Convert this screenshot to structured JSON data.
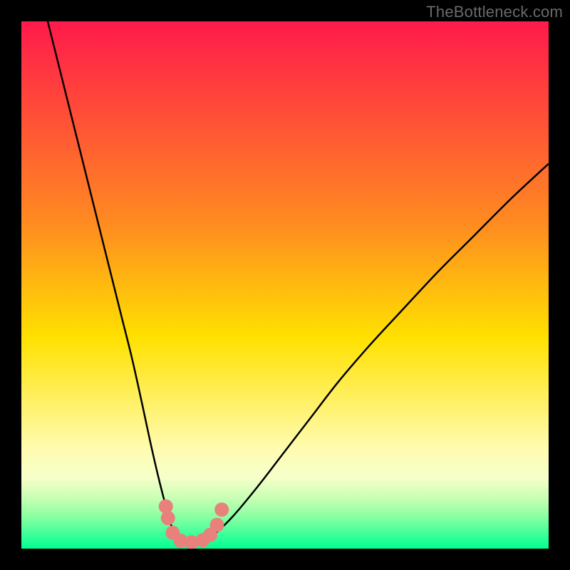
{
  "watermark": "TheBottleneck.com",
  "chart_data": {
    "type": "line",
    "title": "",
    "xlabel": "",
    "ylabel": "",
    "xlim": [
      0,
      100
    ],
    "ylim": [
      0,
      100
    ],
    "grid": false,
    "legend": false,
    "background_gradient": {
      "stops": [
        {
          "pos": 0.0,
          "color": "#ff1a4b"
        },
        {
          "pos": 0.38,
          "color": "#ff8a21"
        },
        {
          "pos": 0.6,
          "color": "#ffe100"
        },
        {
          "pos": 0.81,
          "color": "#fffcb0"
        },
        {
          "pos": 0.865,
          "color": "#f6ffca"
        },
        {
          "pos": 0.905,
          "color": "#c7ffb3"
        },
        {
          "pos": 0.945,
          "color": "#7effa0"
        },
        {
          "pos": 1.0,
          "color": "#00ff94"
        }
      ]
    },
    "series": [
      {
        "name": "bottleneck-curve",
        "color": "#000000",
        "width": 2.5,
        "x": [
          5,
          7,
          9,
          11,
          13,
          15,
          17,
          19,
          21,
          23,
          24.5,
          26,
          27.4,
          28.2,
          29.5,
          31,
          33.5,
          36,
          40,
          45,
          50,
          55,
          60,
          66,
          72,
          79,
          86,
          93,
          100
        ],
        "y": [
          100,
          92,
          84,
          76,
          68,
          60,
          52,
          44,
          36,
          27,
          20,
          13.5,
          8,
          5,
          2.3,
          1.2,
          1.2,
          2.3,
          6,
          12,
          18.5,
          25,
          31.5,
          38.5,
          45,
          52.5,
          59.5,
          66.5,
          73
        ]
      }
    ],
    "markers": {
      "name": "highlight-dots",
      "color": "#e8817b",
      "radius": 10,
      "points": [
        {
          "x": 27.4,
          "y": 8.0
        },
        {
          "x": 27.8,
          "y": 5.8
        },
        {
          "x": 28.7,
          "y": 3.0
        },
        {
          "x": 30.2,
          "y": 1.5
        },
        {
          "x": 32.3,
          "y": 1.2
        },
        {
          "x": 34.4,
          "y": 1.6
        },
        {
          "x": 35.8,
          "y": 2.6
        },
        {
          "x": 37.1,
          "y": 4.5
        },
        {
          "x": 38.0,
          "y": 7.4
        }
      ]
    }
  }
}
